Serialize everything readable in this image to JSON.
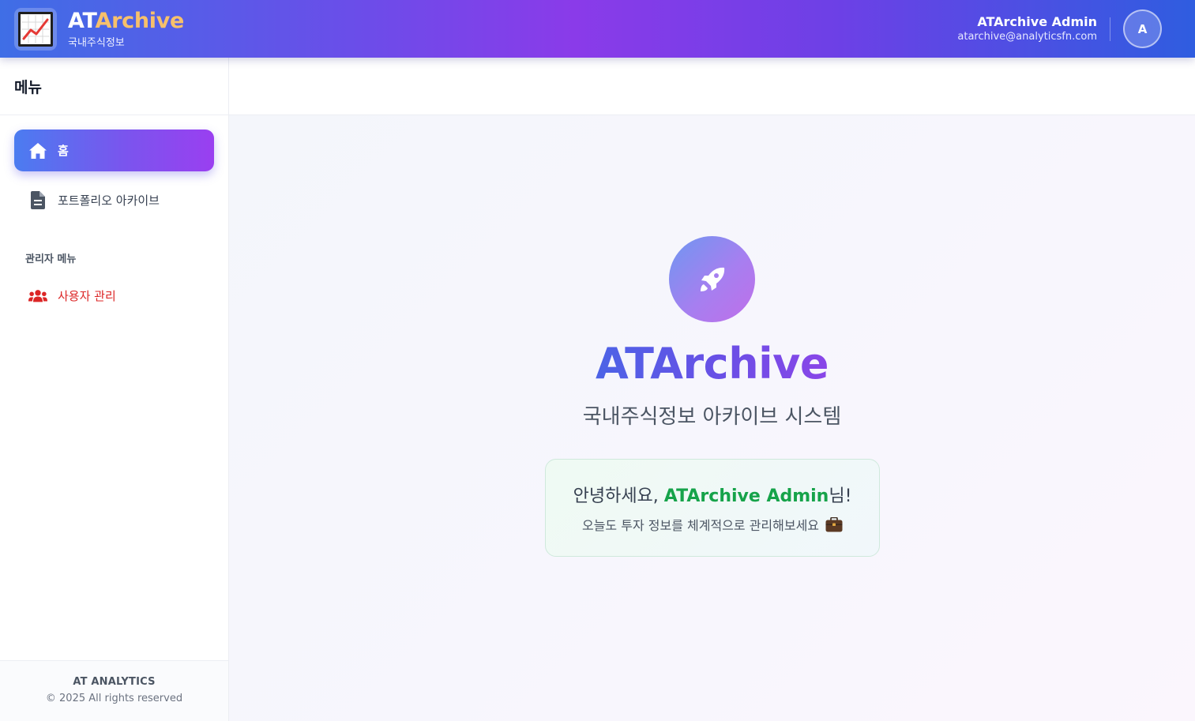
{
  "header": {
    "brand_at": "AT",
    "brand_archive": "Archive",
    "brand_subtitle": "국내주식정보",
    "user_name": "ATArchive Admin",
    "user_email": "atarchive@analyticsfn.com",
    "avatar_initial": "A",
    "logo_icon": "line-chart-icon"
  },
  "sidebar": {
    "title": "메뉴",
    "items": [
      {
        "label": "홈",
        "icon": "home-icon",
        "active": true
      },
      {
        "label": "포트폴리오 아카이브",
        "icon": "document-icon",
        "active": false
      }
    ],
    "admin_section_label": "관리자 메뉴",
    "admin_items": [
      {
        "label": "사용자 관리",
        "icon": "users-icon",
        "color": "#dc2626"
      }
    ],
    "footer": {
      "company": "AT ANALYTICS",
      "copyright": "© 2025 All rights reserved"
    }
  },
  "main": {
    "hero_icon": "rocket-icon",
    "title": "ATArchive",
    "subtitle": "국내주식정보 아카이브 시스템",
    "welcome": {
      "greeting_prefix": "안녕하세요, ",
      "user_name": "ATArchive Admin",
      "greeting_suffix": "님!",
      "message": "오늘도 투자 정보를 체계적으로 관리해보세요",
      "emoji_icon": "briefcase-icon"
    }
  },
  "colors": {
    "header_gradient_start": "#3f6ee6",
    "header_gradient_mid": "#8a3be9",
    "brand_accent": "#f7c06b",
    "active_nav": "#7a55ee",
    "admin_red": "#dc2626",
    "welcome_green": "#16a34a"
  }
}
